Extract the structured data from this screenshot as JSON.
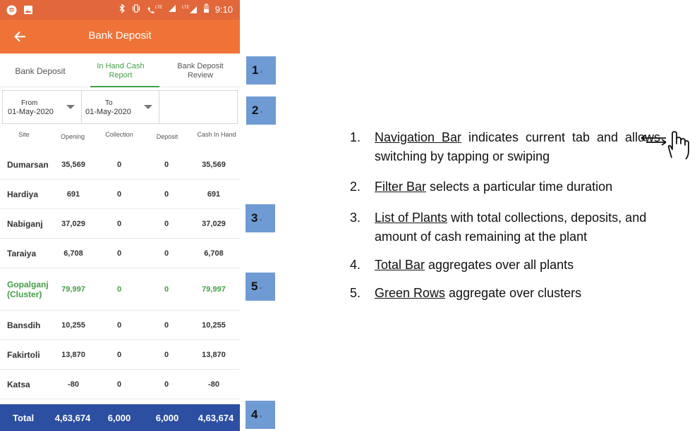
{
  "colors": {
    "status_bar": "#e2673a",
    "app_bar": "#ef7336",
    "active_tab": "#43a047",
    "cluster_row": "#43a047",
    "total_bar": "#2d4fa1",
    "badge": "#6f9bd4"
  },
  "status_bar": {
    "icons": [
      "spotify-icon",
      "image-icon",
      "bluetooth-icon",
      "vibrate-icon",
      "lte-call-icon",
      "signal-icon",
      "lte-signal-icon",
      "battery-icon"
    ],
    "lte_label": "LTE",
    "time": "9:10"
  },
  "app_bar": {
    "back_icon": "arrow-left-icon",
    "title": "Bank Deposit"
  },
  "tabs": [
    {
      "label": "Bank Deposit",
      "active": false
    },
    {
      "label": "In Hand Cash Report",
      "active": true
    },
    {
      "label": "Bank Deposit Review",
      "active": false
    }
  ],
  "filter": {
    "from_label": "From",
    "from_value": "01-May-2020",
    "to_label": "To",
    "to_value": "01-May-2020"
  },
  "table": {
    "headers": [
      "Site",
      "Opening",
      "Collection",
      "Deposit",
      "Cash In Hand"
    ],
    "rows": [
      {
        "site": "Dumarsan",
        "opening": "35,569",
        "collection": "0",
        "deposit": "0",
        "cash": "35,569",
        "cluster": false
      },
      {
        "site": "Hardiya",
        "opening": "691",
        "collection": "0",
        "deposit": "0",
        "cash": "691",
        "cluster": false
      },
      {
        "site": "Nabiganj",
        "opening": "37,029",
        "collection": "0",
        "deposit": "0",
        "cash": "37,029",
        "cluster": false
      },
      {
        "site": "Taraiya",
        "opening": "6,708",
        "collection": "0",
        "deposit": "0",
        "cash": "6,708",
        "cluster": false
      },
      {
        "site": "Gopalganj (Cluster)",
        "opening": "79,997",
        "collection": "0",
        "deposit": "0",
        "cash": "79,997",
        "cluster": true
      },
      {
        "site": "Bansdih",
        "opening": "10,255",
        "collection": "0",
        "deposit": "0",
        "cash": "10,255",
        "cluster": false
      },
      {
        "site": "Fakirtoli",
        "opening": "13,870",
        "collection": "0",
        "deposit": "0",
        "cash": "13,870",
        "cluster": false
      },
      {
        "site": "Katsa",
        "opening": "-80",
        "collection": "0",
        "deposit": "0",
        "cash": "-80",
        "cluster": false
      }
    ],
    "total": {
      "label": "Total",
      "opening": "4,63,674",
      "collection": "6,000",
      "deposit": "6,000",
      "cash": "4,63,674"
    }
  },
  "badges": [
    {
      "num": "1"
    },
    {
      "num": "2"
    },
    {
      "num": "3"
    },
    {
      "num": "5"
    },
    {
      "num": "4"
    }
  ],
  "badge_tick": "‹",
  "notes": [
    {
      "n": "1.",
      "key": "Navigation Bar",
      "rest": " indicates current tab and allows switching by tapping or swiping"
    },
    {
      "n": "2.",
      "key": "Filter Bar",
      "rest": " selects a particular time duration"
    },
    {
      "n": "3.",
      "key": "List of Plants",
      "rest": " with total collections, deposits, and amount of cash remaining at the plant"
    },
    {
      "n": "4.",
      "key": "Total Bar",
      "rest": " aggregates over all plants"
    },
    {
      "n": "5.",
      "key": "Green Rows",
      "rest": " aggregate over clusters"
    }
  ],
  "gesture_icon": "swipe-hand-icon"
}
